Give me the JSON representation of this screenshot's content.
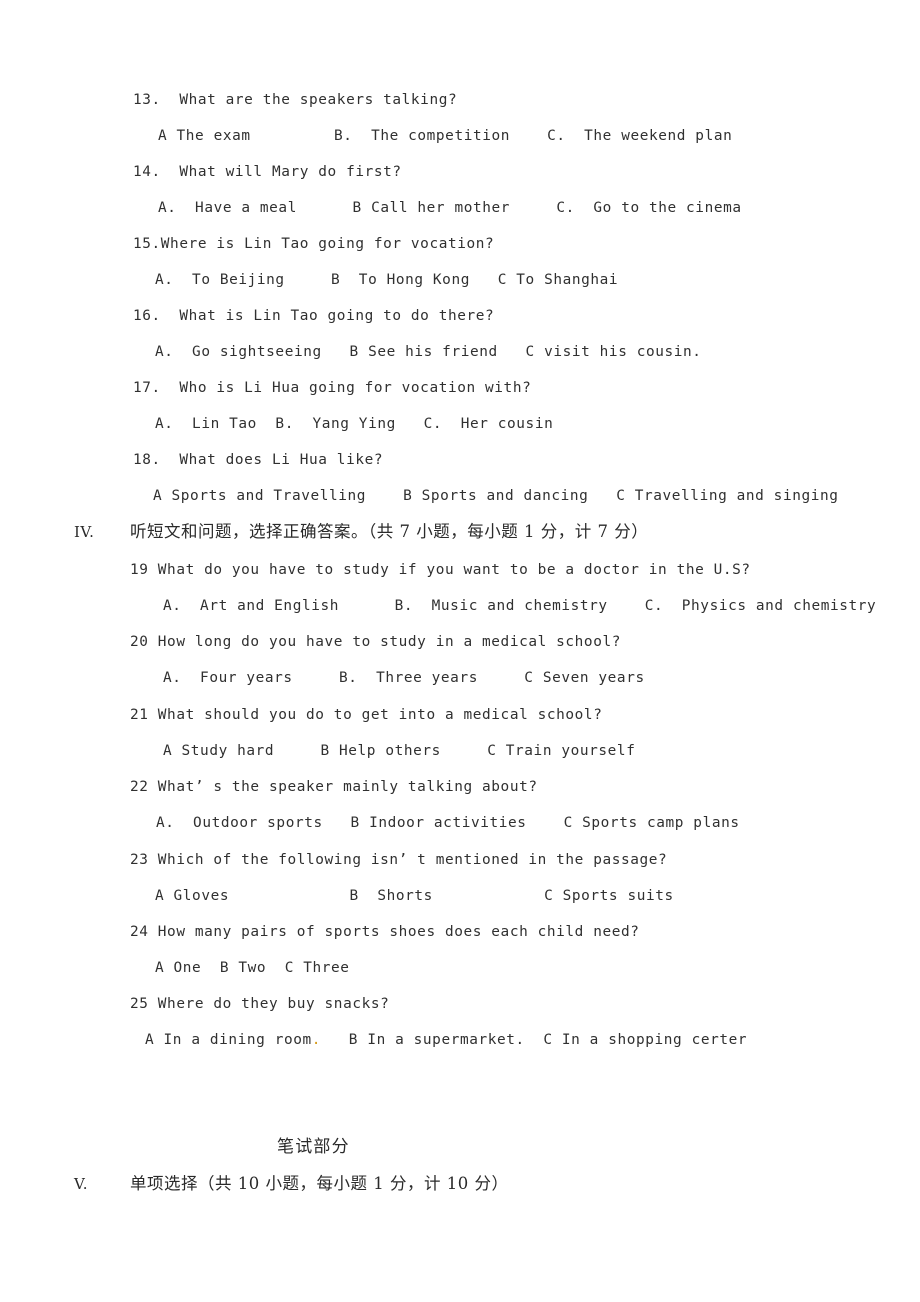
{
  "document": {
    "type": "english-exam-paper",
    "page_background": "#ffffff",
    "text_color": "#303030",
    "accent_mark_color": "#d79b18"
  },
  "listening_part": {
    "questions": [
      {
        "number": "13.",
        "stem": "13.  What are the speakers talking?",
        "options": "A The exam         B.  The competition    C.  The weekend plan"
      },
      {
        "number": "14.",
        "stem": "14.  What will Mary do first?",
        "options": "A.  Have a meal      B Call her mother     C.  Go to the cinema"
      },
      {
        "number": "15.",
        "stem": "15.Where is Lin Tao going for vocation?",
        "options": "A.  To Beijing     B  To Hong Kong   C To Shanghai"
      },
      {
        "number": "16.",
        "stem": "16.  What is Lin Tao going to do there?",
        "options": "A.  Go sightseeing   B See his friend   C visit his cousin."
      },
      {
        "number": "17.",
        "stem": "17.  Who is Li Hua going for vocation with?",
        "options": "A.  Lin Tao  B.  Yang Ying   C.  Her cousin"
      },
      {
        "number": "18.",
        "stem": "18.  What does Li Hua like?",
        "options": "A Sports and Travelling    B Sports and dancing   C Travelling and singing"
      }
    ]
  },
  "section_iv": {
    "roman": "IV.",
    "instruction": "听短文和问题，选择正确答案。（共 7 小题，每小题 1 分，计 7 分）",
    "questions": [
      {
        "number": "19",
        "stem": "19 What do you have to study if you want to be a doctor in the U.S?",
        "options": "A.  Art and English      B.  Music and chemistry    C.  Physics and chemistry"
      },
      {
        "number": "20",
        "stem": "20 How long do you have to study in a medical school?",
        "options": "A.  Four years     B.  Three years     C Seven years"
      },
      {
        "number": "21",
        "stem": "21 What should you do to get into a medical school?",
        "options": "A Study hard     B Help others     C Train yourself"
      },
      {
        "number": "22",
        "stem": "22 What’ s the speaker mainly talking about?",
        "options": "A.  Outdoor sports   B Indoor activities    C Sports camp plans"
      },
      {
        "number": "23",
        "stem": "23 Which of the following isn’ t mentioned in the passage?",
        "options": "A Gloves             B  Shorts            C Sports suits"
      },
      {
        "number": "24",
        "stem": "24 How many pairs of sports shoes does each child need?",
        "options": "A One  B Two  C Three"
      },
      {
        "number": "25",
        "stem": "25 Where do they buy snacks?",
        "options_part1": "A In a dining room",
        "options_mark": ".",
        "options_part2": "   B In a supermarket.  C In a shopping certer"
      }
    ]
  },
  "written_part": {
    "heading": "笔试部分",
    "section_v": {
      "roman": "V.",
      "instruction": "单项选择（共 10 小题，每小题 1 分，计 10 分）"
    }
  }
}
